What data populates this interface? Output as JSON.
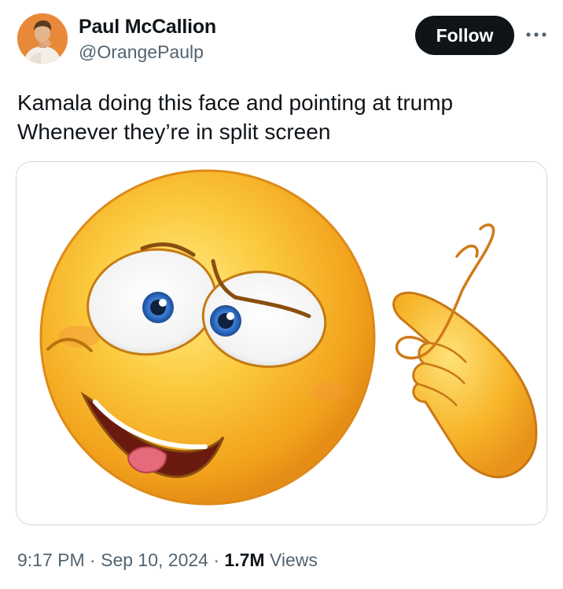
{
  "author": {
    "name": "Paul McCallion",
    "handle": "@OrangePaulp",
    "avatar_icon": "profile-photo"
  },
  "actions": {
    "follow_label": "Follow",
    "more_icon": "more-horizontal-icon"
  },
  "tweet": {
    "text_line1": "Kamala doing this face and pointing at trump",
    "text_line2": "Whenever they’re in split screen"
  },
  "media": {
    "description_icon": "crazy-emoji-pointing-at-head-image"
  },
  "meta": {
    "time": "9:17 PM",
    "separator1": "·",
    "date": "Sep 10, 2024",
    "separator2": "·",
    "views_count": "1.7M",
    "views_label": "Views"
  },
  "colors": {
    "text_primary": "#0f1419",
    "text_secondary": "#536471",
    "border": "#cfd9de",
    "follow_bg": "#0f1419",
    "follow_text": "#ffffff"
  }
}
